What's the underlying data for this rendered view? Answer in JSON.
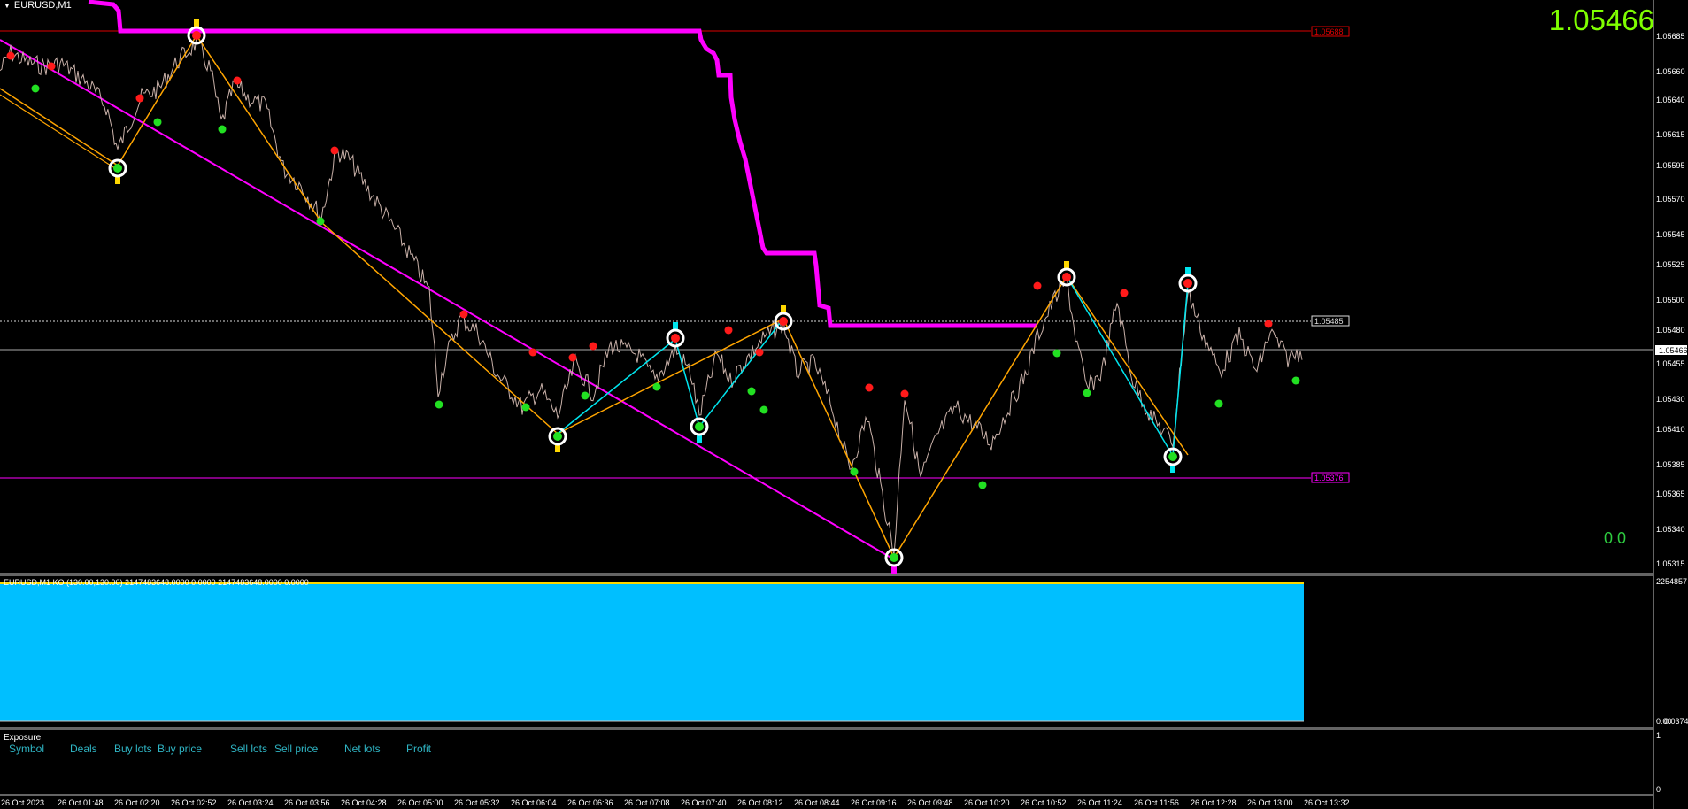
{
  "window": {
    "title": "EURUSD,M1"
  },
  "price": {
    "current": "1.05466",
    "indicator_value": "0.0"
  },
  "levels": {
    "red_label": "1.05688",
    "dotted_label": "1.05485",
    "bid_label": "1.05466",
    "magenta_label": "1.05376"
  },
  "y_axis": [
    "1.05685",
    "1.05660",
    "1.05640",
    "1.05615",
    "1.05595",
    "1.05570",
    "1.05545",
    "1.05525",
    "1.05500",
    "1.05480",
    "1.05455",
    "1.05430",
    "1.05410",
    "1.05385",
    "1.05365",
    "1.05340",
    "1.05315"
  ],
  "x_axis": [
    "26 Oct 2023",
    "26 Oct 01:48",
    "26 Oct 02:20",
    "26 Oct 02:52",
    "26 Oct 03:24",
    "26 Oct 03:56",
    "26 Oct 04:28",
    "26 Oct 05:00",
    "26 Oct 05:32",
    "26 Oct 06:04",
    "26 Oct 06:36",
    "26 Oct 07:08",
    "26 Oct 07:40",
    "26 Oct 08:12",
    "26 Oct 08:44",
    "26 Oct 09:16",
    "26 Oct 09:48",
    "26 Oct 10:20",
    "26 Oct 10:52",
    "26 Oct 11:24",
    "26 Oct 11:56",
    "26 Oct 12:28",
    "26 Oct 13:00",
    "26 Oct 13:32"
  ],
  "indicator": {
    "label": "EURUSD,M1 KO (130.00,130.00) 2147483648.0000 0.0000 2147483648.0000 0.0000",
    "axis_top": "2254857",
    "axis_bottom": "0.00",
    "axis_bottom2": "0.0374"
  },
  "exposure": {
    "title": "Exposure",
    "columns": [
      "Symbol",
      "Deals",
      "Buy lots",
      "Buy price",
      "Sell lots",
      "Sell price",
      "Net lots",
      "Profit"
    ],
    "axis_top": "1",
    "axis_bottom": "0"
  },
  "colors": {
    "price_line": "#c8b0a8",
    "zigzag_orange": "#ffa500",
    "zigzag_cyan": "#00e5ee",
    "magenta": "#ff00ff",
    "red_level": "#dd0000",
    "histogram": "#00bfff",
    "big_price": "#7fff00"
  }
}
